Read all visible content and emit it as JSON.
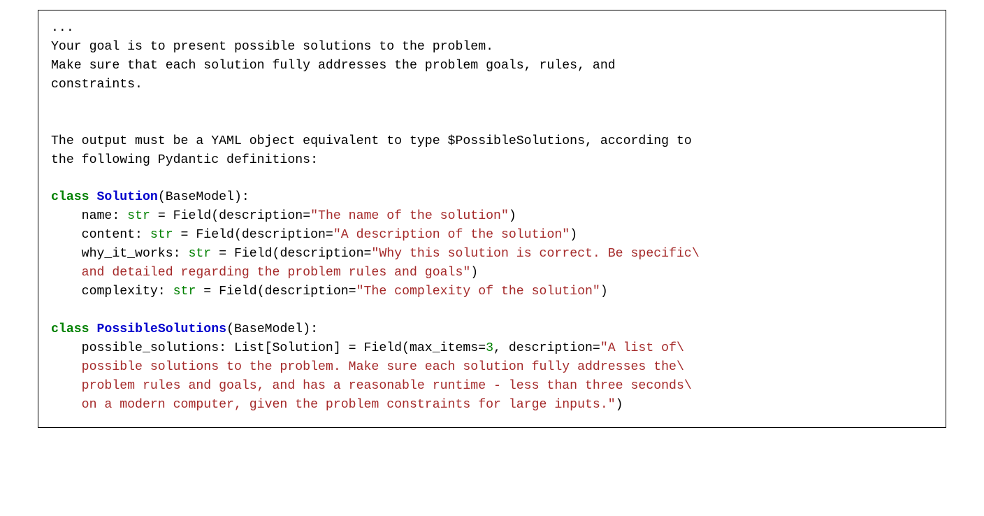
{
  "code": {
    "l1": "...",
    "l2": "Your goal is to present possible solutions to the problem.",
    "l3": "Make sure that each solution fully addresses the problem goals, rules, and",
    "l4": "constraints.",
    "l5": "The output must be a YAML object equivalent to type $PossibleSolutions, according to",
    "l6": "the following Pydantic definitions:",
    "kw_class1": "class",
    "cls_solution": "Solution",
    "base1": "(BaseModel):",
    "sol_name_pre": "    name: ",
    "typ_str": "str",
    "sol_name_mid": " = Field(description=",
    "str_name": "\"The name of the solution\"",
    "paren_close": ")",
    "sol_content_pre": "    content: ",
    "sol_content_mid": " = Field(description=",
    "str_content": "\"A description of the solution\"",
    "sol_why_pre": "    why_it_works: ",
    "sol_why_mid": " = Field(description=",
    "str_why1": "\"Why this solution is correct. Be specific\\",
    "str_why2": "    and detailed regarding the problem rules and goals\"",
    "sol_cx_pre": "    complexity: ",
    "sol_cx_mid": " = Field(description=",
    "str_cx": "\"The complexity of the solution\"",
    "kw_class2": "class",
    "cls_possible": "PossibleSolutions",
    "base2": "(BaseModel):",
    "ps_pre": "    possible_solutions: List[Solution] = Field(max_items=",
    "num_3": "3",
    "ps_mid": ", description=",
    "str_ps1": "\"A list of\\",
    "str_ps2": "    possible solutions to the problem. Make sure each solution fully addresses the\\",
    "str_ps3": "    problem rules and goals, and has a reasonable runtime - less than three seconds\\",
    "str_ps4": "    on a modern computer, given the problem constraints for large inputs.\""
  }
}
